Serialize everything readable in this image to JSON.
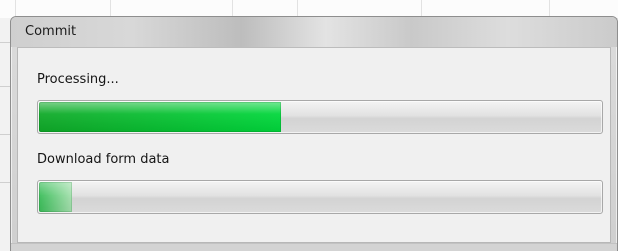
{
  "window": {
    "title": "Commit"
  },
  "steps": [
    {
      "label": "Processing...",
      "progress": 0.43
    },
    {
      "label": "Download form data",
      "progress": 0.06
    }
  ],
  "colors": {
    "progress_fill": "#00d73b",
    "progress_track": "#dcdcdc",
    "window_border": "#8e8e8e"
  }
}
